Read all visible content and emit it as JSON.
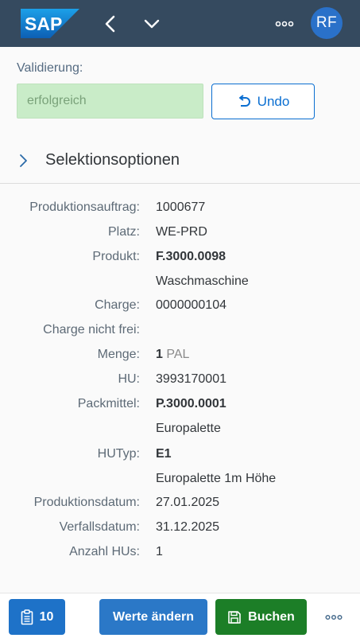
{
  "header": {
    "logo_text": "SAP",
    "avatar_initials": "RF",
    "icons": {
      "back": "back-icon",
      "dropdown": "chevron-down-icon",
      "more": "more-icon"
    }
  },
  "validation": {
    "label": "Validierung:",
    "value": "erfolgreich",
    "undo_label": "Undo",
    "status_color": "#c9ecc8"
  },
  "selection": {
    "title": "Selektionsoptionen",
    "expanded": false
  },
  "fields": {
    "produktionsauftrag": {
      "label": "Produktionsauftrag:",
      "value": "1000677"
    },
    "platz": {
      "label": "Platz:",
      "value": "WE-PRD"
    },
    "produkt": {
      "label": "Produkt:",
      "value": "F.3000.0098",
      "description": "Waschmaschine"
    },
    "charge": {
      "label": "Charge:",
      "value": "0000000104"
    },
    "charge_nicht_frei": {
      "label": "Charge nicht frei:",
      "value": ""
    },
    "menge": {
      "label": "Menge:",
      "value": "1",
      "unit": "PAL"
    },
    "hu": {
      "label": "HU:",
      "value": "3993170001"
    },
    "packmittel": {
      "label": "Packmittel:",
      "value": "P.3000.0001",
      "description": "Europalette"
    },
    "hutyp": {
      "label": "HUTyp:",
      "value": "E1",
      "description": "Europalette 1m Höhe"
    },
    "produktionsdatum": {
      "label": "Produktionsdatum:",
      "value": "27.01.2025"
    },
    "verfallsdatum": {
      "label": "Verfallsdatum:",
      "value": "31.12.2025"
    },
    "anzahl_hus": {
      "label": "Anzahl HUs:",
      "value": "1"
    }
  },
  "footer": {
    "count_label": "10",
    "change_label": "Werte ändern",
    "post_label": "Buchen",
    "colors": {
      "primary": "#1e72c8",
      "success": "#1c7e27"
    }
  }
}
